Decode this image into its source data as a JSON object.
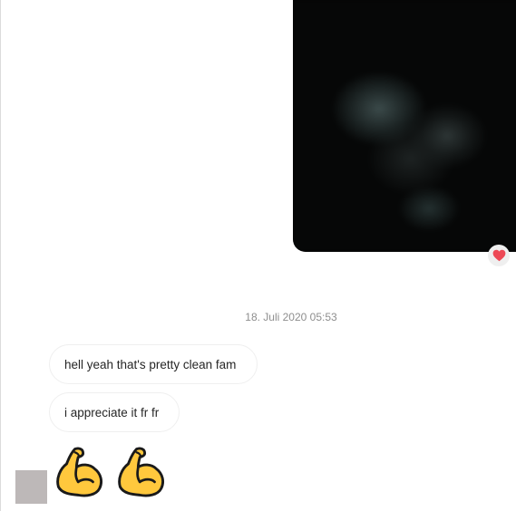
{
  "media": {
    "icon": "blurred-photo",
    "background_color": "#050505"
  },
  "reaction": {
    "icon": "heart-icon",
    "color": "#ed4956"
  },
  "conversation": {
    "timestamp": "18. Juli 2020 05:53",
    "messages": [
      {
        "text": "hell yeah that's pretty clean fam"
      },
      {
        "text": "i appreciate it fr fr"
      }
    ],
    "emoji_message": {
      "icons": [
        "flexed-biceps-icon",
        "flexed-biceps-icon"
      ],
      "color": "#ffc83d"
    }
  },
  "sender": {
    "avatar_icon": "avatar",
    "avatar_color": "#bdb8b8"
  }
}
